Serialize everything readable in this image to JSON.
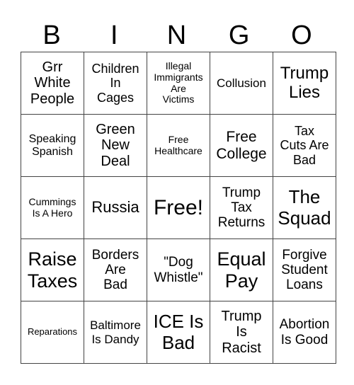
{
  "header": {
    "letters": [
      "B",
      "I",
      "N",
      "G",
      "O"
    ]
  },
  "card": {
    "rows": [
      [
        "Grr\nWhite\nPeople",
        "Children\nIn\nCages",
        "Illegal\nImmigrants\nAre\nVictims",
        "Collusion",
        "Trump\nLies"
      ],
      [
        "Speaking\nSpanish",
        "Green\nNew\nDeal",
        "Free\nHealthcare",
        "Free\nCollege",
        "Tax\nCuts Are\nBad"
      ],
      [
        "Cummings\nIs A Hero",
        "Russia",
        "Free!",
        "Trump\nTax\nReturns",
        "The\nSquad"
      ],
      [
        "Raise\nTaxes",
        "Borders\nAre\nBad",
        "\"Dog\nWhistle\"",
        "Equal\nPay",
        "Forgive\nStudent\nLoans"
      ],
      [
        "Reparations",
        "Baltimore\nIs Dandy",
        "ICE Is\nBad",
        "Trump\nIs\nRacist",
        "Abortion\nIs Good"
      ]
    ]
  }
}
